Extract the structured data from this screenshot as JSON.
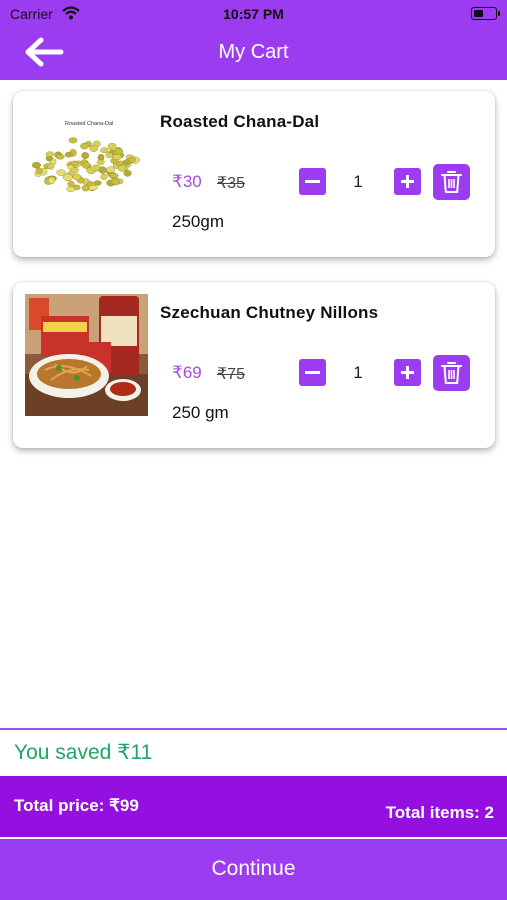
{
  "status_bar": {
    "carrier": "Carrier",
    "time": "10:57 PM"
  },
  "header": {
    "title": "My Cart",
    "back_icon": "arrow-left-icon"
  },
  "colors": {
    "accent": "#9b3cf0",
    "totals_bar": "#9410e0",
    "price": "#a24ee0",
    "saved": "#22a565"
  },
  "cart": {
    "items": [
      {
        "name": "Roasted Chana-Dal",
        "price": "₹30",
        "mrp": "₹35",
        "quantity": "1",
        "weight": "250gm",
        "image_label": "Roasted Chana-Dal"
      },
      {
        "name": "Szechuan Chutney Nillons",
        "price": "₹69",
        "mrp": "₹75",
        "quantity": "1",
        "weight": "250 gm"
      }
    ]
  },
  "summary": {
    "saved": "You saved ₹11",
    "total_price": "Total price: ₹99",
    "total_items": "Total items: 2",
    "continue_label": "Continue"
  }
}
